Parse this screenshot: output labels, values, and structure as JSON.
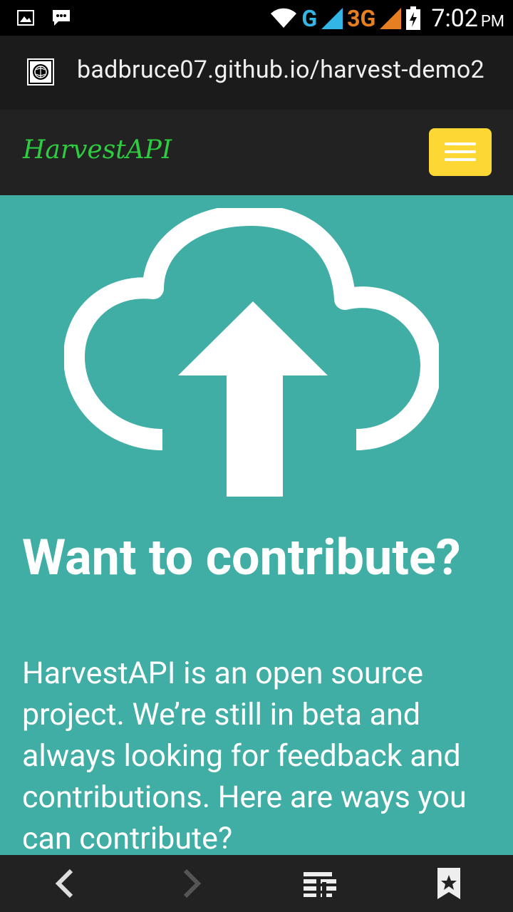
{
  "status_bar": {
    "network_g": "G",
    "network_3g": "3G",
    "time": "7:02",
    "ampm": "PM"
  },
  "browser": {
    "url": "badbruce07.github.io/harvest-demo2"
  },
  "navbar": {
    "brand": "HarvestAPI",
    "menu_button_color": "#fdd835"
  },
  "hero": {
    "icon": "cloud-upload-icon",
    "headline": "Want to contribute?",
    "body": "HarvestAPI is an open source project. We’re still in beta and always looking for feedback and contributions. Here are ways you can contribute?",
    "background": "#41aea5"
  },
  "bottom_bar": {
    "icons": [
      "back-arrow-icon",
      "forward-arrow-icon",
      "tabs-icon",
      "bookmark-icon"
    ]
  }
}
